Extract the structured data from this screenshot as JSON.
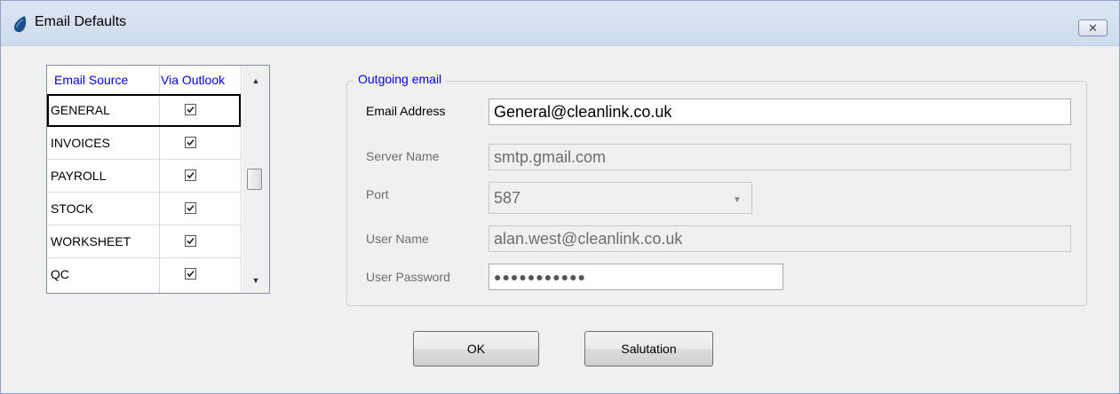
{
  "window": {
    "title": "Email Defaults",
    "close_label": "✕",
    "app_icon": "blue-drop-icon"
  },
  "grid": {
    "columns": [
      "Email Source",
      "Via Outlook"
    ],
    "rows": [
      {
        "source": "GENERAL",
        "via_outlook": true
      },
      {
        "source": "INVOICES",
        "via_outlook": true
      },
      {
        "source": "PAYROLL",
        "via_outlook": true
      },
      {
        "source": "STOCK",
        "via_outlook": true
      },
      {
        "source": "WORKSHEET",
        "via_outlook": true
      },
      {
        "source": "QC",
        "via_outlook": true
      }
    ],
    "scroll_up": "▲",
    "scroll_down": "▼"
  },
  "outgoing": {
    "legend": "Outgoing email",
    "email_address_label": "Email Address",
    "email_address": "General@cleanlink.co.uk",
    "server_name_label": "Server Name",
    "server_name": "smtp.gmail.com",
    "port_label": "Port",
    "port": "587",
    "user_name_label": "User Name",
    "user_name": "alan.west@cleanlink.co.uk",
    "user_password_label": "User Password",
    "user_password": "●●●●●●●●●●●"
  },
  "buttons": {
    "ok": "OK",
    "salutation": "Salutation"
  },
  "colors": {
    "header_text": "#0000ff",
    "titlebar": "#dbe6f4"
  }
}
